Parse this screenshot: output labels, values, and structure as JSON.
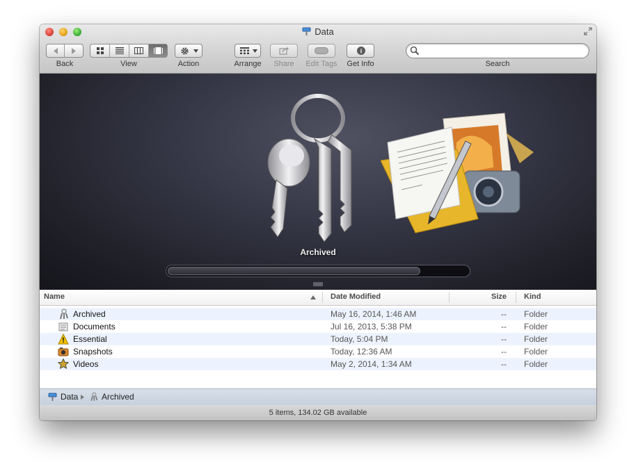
{
  "window": {
    "title": "Data",
    "title_icon": "drive-icon"
  },
  "toolbar": {
    "back_label": "Back",
    "view_label": "View",
    "action_label": "Action",
    "arrange_label": "Arrange",
    "share_label": "Share",
    "edit_tags_label": "Edit Tags",
    "get_info_label": "Get Info",
    "search_label": "Search",
    "search_value": "",
    "active_view": "cover-flow"
  },
  "preview": {
    "title": "Archived",
    "scrubber_position": 0.84
  },
  "columns": {
    "name": "Name",
    "date_modified": "Date Modified",
    "size": "Size",
    "kind": "Kind",
    "sort": "ascending"
  },
  "files": [
    {
      "name": "Archived",
      "date": "May 16, 2014, 1:46 AM",
      "size": "--",
      "kind": "Folder",
      "icon": "keychain-icon"
    },
    {
      "name": "Documents",
      "date": "Jul 16, 2013, 5:38 PM",
      "size": "--",
      "kind": "Folder",
      "icon": "document-icon"
    },
    {
      "name": "Essential",
      "date": "Today, 5:04 PM",
      "size": "--",
      "kind": "Folder",
      "icon": "warning-icon"
    },
    {
      "name": "Snapshots",
      "date": "Today, 12:36 AM",
      "size": "--",
      "kind": "Folder",
      "icon": "camera-icon"
    },
    {
      "name": "Videos",
      "date": "May 2, 2014, 1:34 AM",
      "size": "--",
      "kind": "Folder",
      "icon": "movie-star-icon"
    }
  ],
  "path": [
    "Data",
    "Archived"
  ],
  "status": "5 items, 134.02 GB available"
}
